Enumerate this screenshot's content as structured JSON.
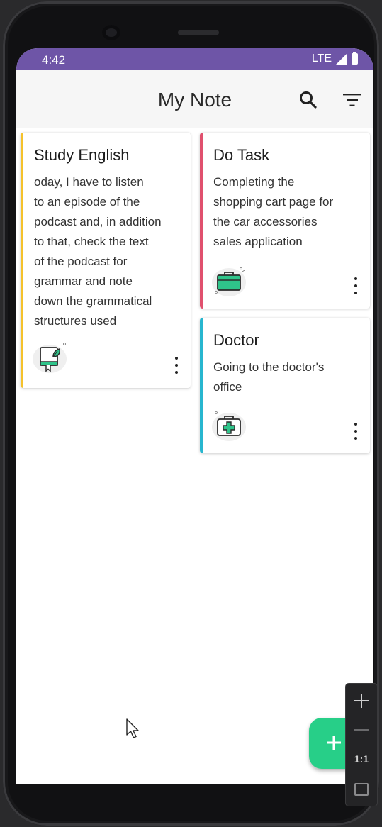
{
  "status_bar": {
    "time": "4:42",
    "network": "LTE"
  },
  "app_bar": {
    "title": "My Note"
  },
  "notes": [
    {
      "title": "Study English",
      "body": [
        "oday, I have to listen",
        "to an episode of the",
        "podcast and, in addition",
        "to that, check the text",
        "of the podcast for",
        "grammar and note",
        "down the grammatical",
        "structures used"
      ],
      "icon": "book-leaf-icon",
      "stripe_color": "#f5c22b"
    },
    {
      "title": "Do Task",
      "body": [
        "Completing the",
        "shopping cart page for",
        "the car accessories",
        "sales application"
      ],
      "icon": "briefcase-icon",
      "stripe_color": "#e0506e"
    },
    {
      "title": "Doctor",
      "body": [
        "Going to the doctor's",
        "office"
      ],
      "icon": "medical-kit-icon",
      "stripe_color": "#27b6cf"
    }
  ],
  "zoom_controls": {
    "reset_label": "1:1"
  },
  "colors": {
    "status_bar": "#6e55a7",
    "fab": "#27cf88",
    "icon_green": "#2fc48a"
  }
}
